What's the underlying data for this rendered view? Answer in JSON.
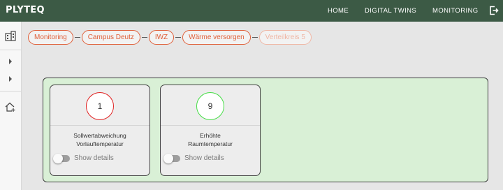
{
  "header": {
    "logo": "PLYTEQ",
    "nav": [
      "HOME",
      "DIGITAL TWINS",
      "MONITORING"
    ],
    "logout_icon": "logout-icon"
  },
  "sidebar": {
    "icons": [
      "building-icon",
      "chevron-right-icon",
      "chevron-right-icon",
      "home-add-icon"
    ]
  },
  "breadcrumbs": [
    {
      "label": "Monitoring",
      "enabled": true
    },
    {
      "label": "Campus Deutz",
      "enabled": true
    },
    {
      "label": "IWZ",
      "enabled": true
    },
    {
      "label": "Wärme versorgen",
      "enabled": true
    },
    {
      "label": "Verteilkreis 5",
      "enabled": false
    }
  ],
  "cards": [
    {
      "count": "1",
      "status_color": "#e02020",
      "title_line1": "Sollwertabweichung",
      "title_line2": "Vorlauftemperatur",
      "toggle_label": "Show details",
      "toggle_on": false
    },
    {
      "count": "9",
      "status_color": "#44dd44",
      "title_line1": "Erhöhte",
      "title_line2": "Raumtemperatur",
      "toggle_label": "Show details",
      "toggle_on": false
    }
  ],
  "colors": {
    "header_bg": "#3c5a45",
    "accent": "#e0603a",
    "panel_bg": "#d9f0d6"
  }
}
